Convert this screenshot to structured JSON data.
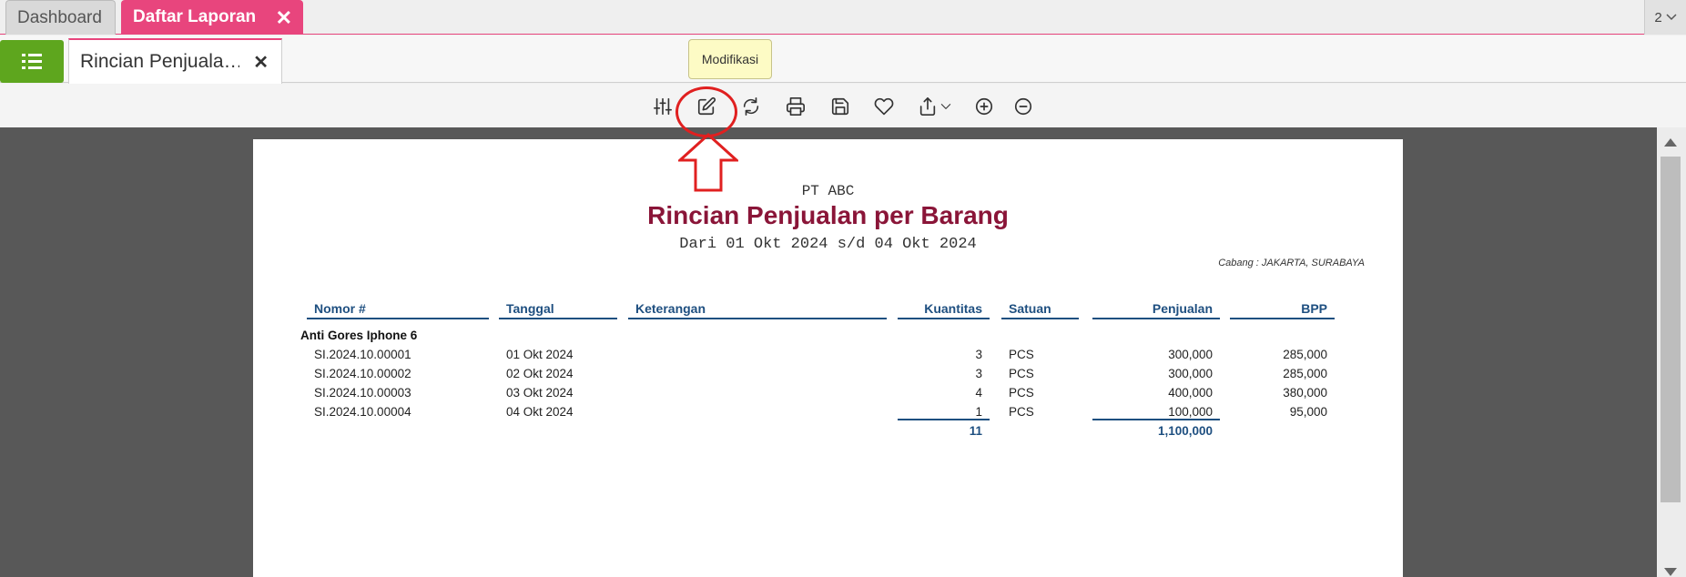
{
  "tabs": {
    "dashboard": "Dashboard",
    "daftar_laporan": "Daftar Laporan",
    "close_symbol": "✕",
    "open_count": "2"
  },
  "report_tab": {
    "title": "Rincian Penjuala…",
    "close_symbol": "✕"
  },
  "toolbar": {
    "icons": [
      "sliders-icon",
      "edit-icon",
      "refresh-icon",
      "print-icon",
      "save-icon",
      "heart-icon",
      "export-icon",
      "zoom-in-icon",
      "zoom-out-icon"
    ],
    "tooltip": "Modifikasi"
  },
  "report": {
    "company": "PT ABC",
    "title": "Rincian Penjualan per Barang",
    "period": "Dari 01 Okt 2024 s/d 04 Okt 2024",
    "branch": "Cabang : JAKARTA, SURABAYA",
    "headers": {
      "nomor": "Nomor #",
      "tanggal": "Tanggal",
      "keterangan": "Keterangan",
      "kuantitas": "Kuantitas",
      "satuan": "Satuan",
      "penjualan": "Penjualan",
      "bpp": "BPP"
    },
    "group": "Anti Gores Iphone 6",
    "rows": [
      {
        "nomor": "SI.2024.10.00001",
        "tanggal": "01 Okt 2024",
        "kuantitas": "3",
        "satuan": "PCS",
        "penjualan": "300,000",
        "bpp": "285,000"
      },
      {
        "nomor": "SI.2024.10.00002",
        "tanggal": "02 Okt 2024",
        "kuantitas": "3",
        "satuan": "PCS",
        "penjualan": "300,000",
        "bpp": "285,000"
      },
      {
        "nomor": "SI.2024.10.00003",
        "tanggal": "03 Okt 2024",
        "kuantitas": "4",
        "satuan": "PCS",
        "penjualan": "400,000",
        "bpp": "380,000"
      },
      {
        "nomor": "SI.2024.10.00004",
        "tanggal": "04 Okt 2024",
        "kuantitas": "1",
        "satuan": "PCS",
        "penjualan": "100,000",
        "bpp": "95,000"
      }
    ],
    "totals": {
      "kuantitas": "11",
      "penjualan": "1,100,000"
    }
  },
  "colors": {
    "accent_pink": "#e8457d",
    "menu_green": "#5ea61e",
    "title_maroon": "#8a1538",
    "header_blue": "#1e4f80",
    "annotation_red": "#e02020"
  }
}
